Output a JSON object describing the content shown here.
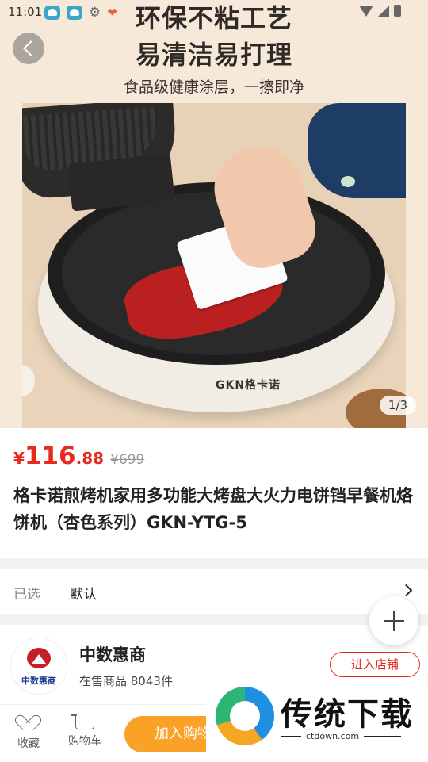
{
  "status_bar": {
    "time": "11:01"
  },
  "hero": {
    "headline_line1": "环保不粘工艺",
    "headline_line2": "易清洁易打理",
    "subline": "食品级健康涂层，一擦即净",
    "product_brand": "GKN格卡诺",
    "page_indicator": "1/3"
  },
  "product": {
    "price_symbol": "¥",
    "price_integer": "116",
    "price_decimal": ".88",
    "original_price": "¥699",
    "title": "格卡诺煎烤机家用多功能大烤盘大火力电饼铛早餐机烙饼机（杏色系列）GKN-YTG-5"
  },
  "selection": {
    "label": "已选",
    "value": "默认"
  },
  "store": {
    "logo_text": "中数惠商",
    "name": "中数惠商",
    "items_on_sale": "在售商品 8043件",
    "enter_button": "进入店铺"
  },
  "bottom_bar": {
    "favorite_label": "收藏",
    "cart_label": "购物车",
    "add_to_cart_label": "加入购物车"
  },
  "watermark": {
    "title": "传统下载",
    "url": "ctdown.com"
  },
  "colors": {
    "price_red": "#e62b1e",
    "add_cart_orange": "#f9a227"
  }
}
